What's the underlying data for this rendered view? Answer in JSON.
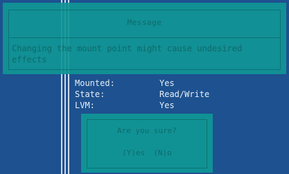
{
  "info": {
    "rows": [
      {
        "key": "Mounted:",
        "value": "Yes"
      },
      {
        "key": "State:",
        "value": "Read/Write"
      },
      {
        "key": "LVM:",
        "value": "Yes"
      }
    ]
  },
  "message_dialog": {
    "title": "Message",
    "body": "Changing the mount point might cause undesired effects"
  },
  "confirm_dialog": {
    "question": "Are you sure?",
    "yes_label": "(Y)es",
    "no_label": "(N)o"
  }
}
